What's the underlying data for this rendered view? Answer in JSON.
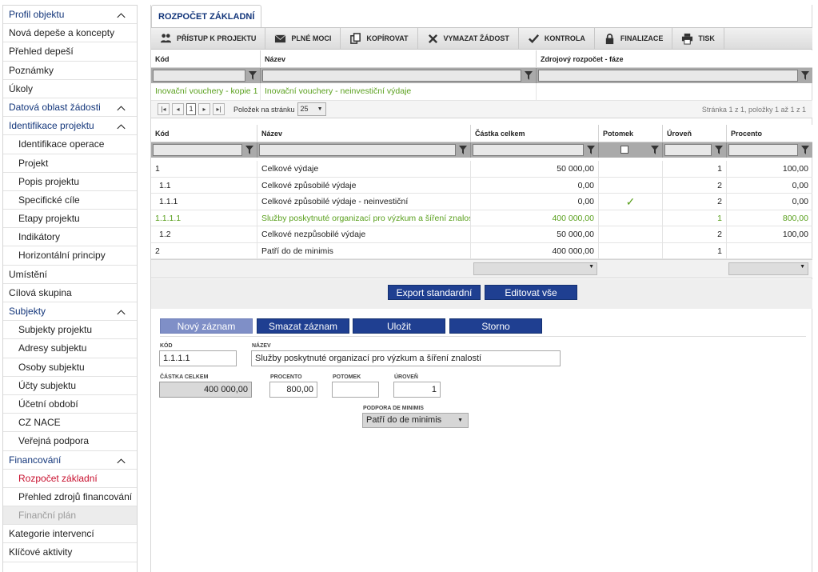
{
  "sidebar": {
    "items": [
      {
        "label": "Profil objektu",
        "type": "sec",
        "chevron": true
      },
      {
        "label": "Nová depeše a koncepty",
        "type": "item"
      },
      {
        "label": "Přehled depeší",
        "type": "item"
      },
      {
        "label": "Poznámky",
        "type": "item"
      },
      {
        "label": "Úkoly",
        "type": "item"
      },
      {
        "label": "Datová oblast žádosti",
        "type": "sec",
        "chevron": true
      },
      {
        "label": "Identifikace projektu",
        "type": "sec",
        "chevron": true
      },
      {
        "label": "Identifikace operace",
        "type": "sub"
      },
      {
        "label": "Projekt",
        "type": "sub"
      },
      {
        "label": "Popis projektu",
        "type": "sub"
      },
      {
        "label": "Specifické cíle",
        "type": "sub"
      },
      {
        "label": "Etapy projektu",
        "type": "sub"
      },
      {
        "label": "Indikátory",
        "type": "sub"
      },
      {
        "label": "Horizontální principy",
        "type": "sub"
      },
      {
        "label": "Umístění",
        "type": "item"
      },
      {
        "label": "Cílová skupina",
        "type": "item"
      },
      {
        "label": "Subjekty",
        "type": "sec",
        "chevron": true
      },
      {
        "label": "Subjekty projektu",
        "type": "sub"
      },
      {
        "label": "Adresy subjektu",
        "type": "sub"
      },
      {
        "label": "Osoby subjektu",
        "type": "sub"
      },
      {
        "label": "Účty subjektu",
        "type": "sub"
      },
      {
        "label": "Účetní období",
        "type": "sub"
      },
      {
        "label": "CZ NACE",
        "type": "sub"
      },
      {
        "label": "Veřejná podpora",
        "type": "sub"
      },
      {
        "label": "Financování",
        "type": "sec",
        "chevron": true
      },
      {
        "label": "Rozpočet základní",
        "type": "sub active"
      },
      {
        "label": "Přehled zdrojů financování",
        "type": "sub"
      },
      {
        "label": "Finanční plán",
        "type": "sub disabled"
      },
      {
        "label": "Kategorie intervencí",
        "type": "item"
      },
      {
        "label": "Klíčové aktivity",
        "type": "item"
      }
    ]
  },
  "tab": {
    "label": "ROZPOČET ZÁKLADNÍ"
  },
  "toolbar": {
    "buttons": [
      {
        "label": "PŘÍSTUP K PROJEKTU",
        "icon": "people-icon"
      },
      {
        "label": "PLNÉ MOCI",
        "icon": "envelope-icon"
      },
      {
        "label": "KOPÍROVAT",
        "icon": "copy-icon"
      },
      {
        "label": "VYMAZAT ŽÁDOST",
        "icon": "x-icon"
      },
      {
        "label": "KONTROLA",
        "icon": "check-icon"
      },
      {
        "label": "FINALIZACE",
        "icon": "lock-icon"
      },
      {
        "label": "TISK",
        "icon": "printer-icon"
      }
    ]
  },
  "top_grid": {
    "headers": [
      "Kód",
      "Název",
      "Zdrojový rozpočet - fáze"
    ],
    "row": [
      "Inovační vouchery - kopie 1",
      "Inovační vouchery - neinvestiční výdaje",
      ""
    ],
    "pager": {
      "page": "1",
      "per_page_label": "Položek na stránku",
      "per_page": "25",
      "info": "Stránka 1 z 1, položky 1 až 1 z 1"
    }
  },
  "main_grid": {
    "headers": [
      "Kód",
      "Název",
      "Částka celkem",
      "Potomek",
      "Úroveň",
      "Procento"
    ],
    "rows": [
      {
        "kod": "1",
        "nazev": "Celkové výdaje",
        "castka": "50 000,00",
        "potomek": "",
        "uroven": "1",
        "procento": "100,00",
        "green": false
      },
      {
        "kod": "1.1",
        "nazev": "Celkové způsobilé výdaje",
        "castka": "0,00",
        "potomek": "",
        "uroven": "2",
        "procento": "0,00",
        "green": false
      },
      {
        "kod": "1.1.1",
        "nazev": "Celkové způsobilé výdaje - neinvestiční",
        "castka": "0,00",
        "potomek": "✓",
        "uroven": "2",
        "procento": "0,00",
        "green": false
      },
      {
        "kod": "1.1.1.1",
        "nazev": "Služby poskytnuté organizací pro výzkum a šíření znalostí",
        "castka": "400 000,00",
        "potomek": "",
        "uroven": "1",
        "procento": "800,00",
        "green": true
      },
      {
        "kod": "1.2",
        "nazev": "Celkové nezpůsobilé výdaje",
        "castka": "50 000,00",
        "potomek": "",
        "uroven": "2",
        "procento": "100,00",
        "green": false
      },
      {
        "kod": "2",
        "nazev": "Patří do de minimis",
        "castka": "400 000,00",
        "potomek": "",
        "uroven": "1",
        "procento": "",
        "green": false
      }
    ]
  },
  "actions": {
    "export": "Export standardní",
    "edit_all": "Editovat vše"
  },
  "form_buttons": {
    "new": "Nový záznam",
    "delete": "Smazat záznam",
    "save": "Uložit",
    "cancel": "Storno"
  },
  "form": {
    "kod_label": "KÓD",
    "kod": "1.1.1.1",
    "nazev_label": "NÁZEV",
    "nazev": "Služby poskytnuté organizací pro výzkum a šíření znalostí",
    "castka_label": "ČÁSTKA CELKEM",
    "castka": "400 000,00",
    "procento_label": "PROCENTO",
    "procento": "800,00",
    "potomek_label": "POTOMEK",
    "potomek": "",
    "uroven_label": "ÚROVEŇ",
    "uroven": "1",
    "deminimis_label": "PODPORA DE MINIMIS",
    "deminimis": "Patří do de minimis"
  },
  "colors": {
    "nav_blue": "#12357a",
    "active_red": "#c8102e",
    "green": "#5aa01e",
    "button_blue": "#1f3f91"
  }
}
